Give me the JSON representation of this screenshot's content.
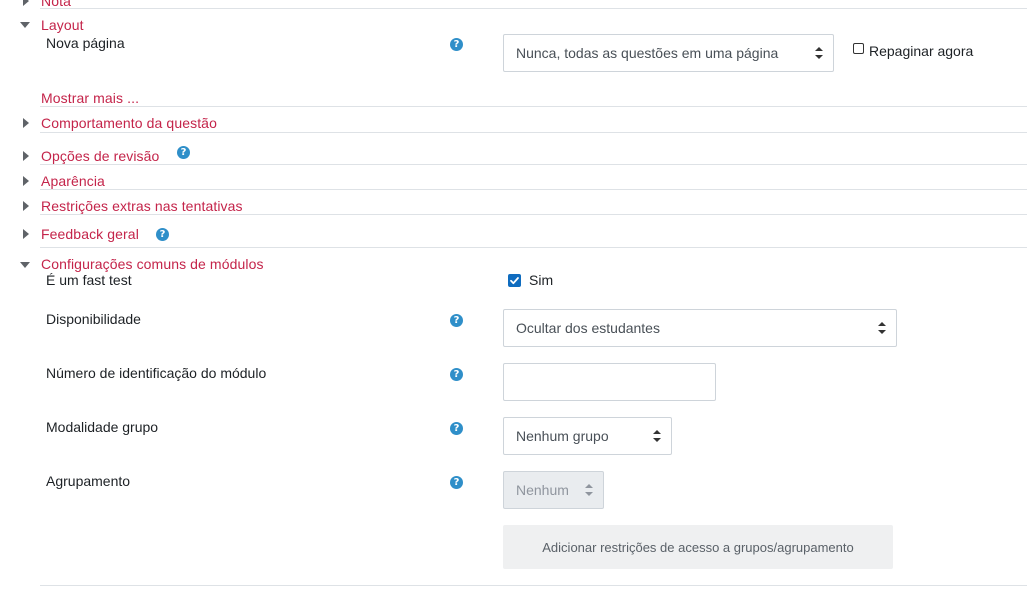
{
  "sections": {
    "nota": "Nota",
    "layout": "Layout",
    "mostrar_mais": "Mostrar mais ...",
    "comportamento": "Comportamento da questão",
    "opcoes_revisao": "Opções de revisão",
    "aparencia": "Aparência",
    "restricoes": "Restrições extras nas tentativas",
    "feedback": "Feedback geral",
    "configuracoes": "Configurações comuns de módulos"
  },
  "layout": {
    "nova_pagina_label": "Nova página",
    "nova_pagina_value": "Nunca, todas as questões em uma página",
    "repaginar_label": "Repaginar agora"
  },
  "common": {
    "fast_test_label": "É um fast test",
    "fast_test_value": "Sim",
    "disponibilidade_label": "Disponibilidade",
    "disponibilidade_value": "Ocultar dos estudantes",
    "idnumber_label": "Número de identificação do módulo",
    "idnumber_value": "",
    "modalidade_label": "Modalidade grupo",
    "modalidade_value": "Nenhum grupo",
    "agrupamento_label": "Agrupamento",
    "agrupamento_value": "Nenhum",
    "add_restrictions_button": "Adicionar restrições de acesso a grupos/agrupamento"
  },
  "icons": {
    "help": "question-circle-icon",
    "collapsed": "caret-right-icon",
    "expanded": "caret-down-icon",
    "select_arrows": "sort-arrows-icon"
  },
  "colors": {
    "link": "#c4244a",
    "help": "#2f8fc9",
    "checkbox": "#0f6cbf",
    "divider": "#dee2e6"
  }
}
